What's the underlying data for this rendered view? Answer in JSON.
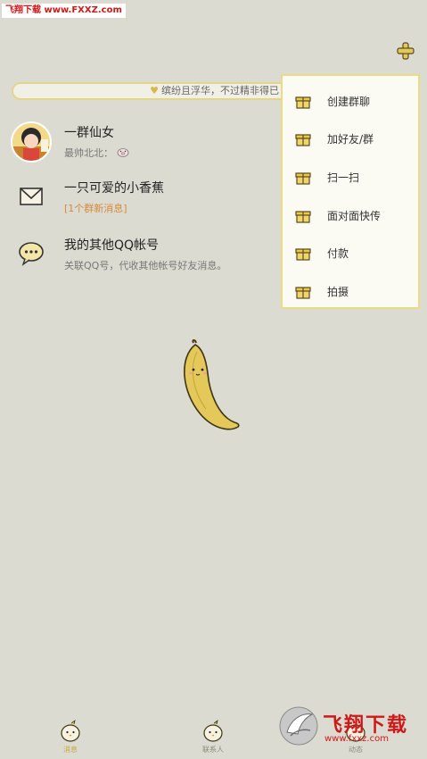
{
  "watermark": {
    "top_text": "飞翔下载 www.FXXZ.com",
    "logo_name": "飞翔下载",
    "logo_url": "www.fxxz.com"
  },
  "header": {
    "plus_icon": "plus-icon"
  },
  "signature": {
    "text": "缤纷且浮华，不过精非得已"
  },
  "conversations": [
    {
      "title": "一群仙女",
      "subtitle": "最帅北北：",
      "subtitle_icon": "pig-emoji-icon",
      "icon": "group-avatar"
    },
    {
      "title": "一只可爱的小香蕉",
      "subtitle": "[1个群新消息]",
      "icon": "envelope-icon",
      "subtitle_color": "#d68a3a"
    },
    {
      "title": "我的其他QQ帐号",
      "subtitle": "关联QQ号，代收其他帐号好友消息。",
      "icon": "chat-bubble-icon"
    }
  ],
  "menu": {
    "items": [
      {
        "label": "创建群聊",
        "icon": "gift-icon"
      },
      {
        "label": "加好友/群",
        "icon": "gift-icon"
      },
      {
        "label": "扫一扫",
        "icon": "gift-icon"
      },
      {
        "label": "面对面快传",
        "icon": "gift-icon"
      },
      {
        "label": "付款",
        "icon": "gift-icon"
      },
      {
        "label": "拍摄",
        "icon": "gift-icon"
      }
    ]
  },
  "tabbar": {
    "tabs": [
      {
        "label": "消息",
        "active": true
      },
      {
        "label": "联系人",
        "active": false
      },
      {
        "label": "动态",
        "active": false
      }
    ]
  },
  "colors": {
    "background": "#dcdbd1",
    "accent": "#e9dc85",
    "banana": "#e4c85a"
  }
}
